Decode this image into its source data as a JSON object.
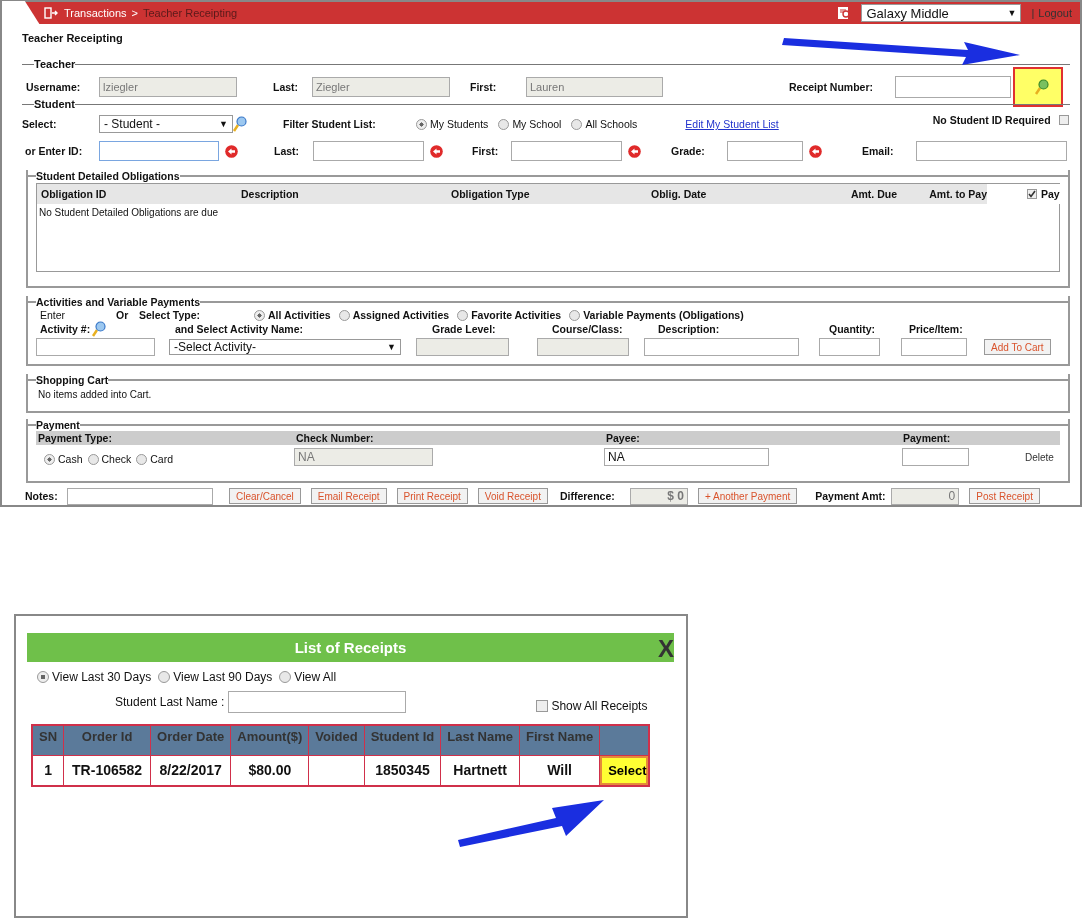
{
  "header": {
    "breadcrumb_root": "Transactions",
    "breadcrumb_separator": ">",
    "breadcrumb_current": "Teacher Receipting",
    "school": "Galaxy Middle",
    "school_caret": "▼",
    "separator": "|",
    "logout": "Logout"
  },
  "page_title": "Teacher Receipting",
  "teacher": {
    "legend": "Teacher",
    "fields": [
      {
        "label": "Username:",
        "value": "lziegler"
      },
      {
        "label": "Last:",
        "value": "Ziegler"
      },
      {
        "label": "First:",
        "value": "Lauren"
      }
    ],
    "receipt_label": "Receipt Number:"
  },
  "student": {
    "legend": "Student",
    "select_label": "Select:",
    "select_value": "- Student -",
    "select_caret": "▼",
    "filter_label": "Filter Student List:",
    "filter_options": [
      {
        "label": "My Students",
        "selected": true
      },
      {
        "label": "My School",
        "selected": false
      },
      {
        "label": "All Schools",
        "selected": false
      }
    ],
    "edit_link": "Edit My Student List",
    "no_id": {
      "label": "No Student ID Required",
      "checked": false
    },
    "id_label": "or Enter ID:",
    "search_fields": [
      {
        "label": "Last:"
      },
      {
        "label": "First:"
      },
      {
        "label": "Grade:"
      }
    ],
    "email_label": "Email:"
  },
  "obligations": {
    "legend": "Student Detailed Obligations",
    "columns": [
      "Obligation ID",
      "Description",
      "Obligation Type",
      "Oblig. Date",
      "Amt. Due",
      "Amt. to Pay"
    ],
    "pay": {
      "label": "Pay",
      "checked": true
    },
    "empty_message": "No Student Detailed Obligations are due"
  },
  "activities": {
    "legend": "Activities and Variable Payments",
    "enter_label": "Enter",
    "activity_label": "Activity #:",
    "or_label": "Or",
    "type_label": "Select Type:",
    "types": [
      {
        "label": "All Activities",
        "selected": true
      },
      {
        "label": "Assigned Activities",
        "selected": false
      },
      {
        "label": "Favorite Activities",
        "selected": false
      },
      {
        "label": "Variable Payments (Obligations)",
        "selected": false
      }
    ],
    "name_label": "and Select Activity Name:",
    "activity_select": "-Select Activity-",
    "activity_caret": "▼",
    "grade_label": "Grade Level:",
    "course_label": "Course/Class:",
    "description_label": "Description:",
    "quantity_label": "Quantity:",
    "price_label": "Price/Item:",
    "add_button": "Add To Cart"
  },
  "cart": {
    "legend": "Shopping Cart",
    "message": "No items added into Cart."
  },
  "payment": {
    "legend": "Payment",
    "headers": [
      "Payment Type:",
      "Check Number:",
      "Payee:",
      "Payment:"
    ],
    "methods": [
      {
        "label": "Cash",
        "selected": true
      },
      {
        "label": "Check",
        "selected": false
      },
      {
        "label": "Card",
        "selected": false
      }
    ],
    "check_number": "NA",
    "payee": "NA",
    "delete": "Delete"
  },
  "footer": {
    "notes_label": "Notes:",
    "buttons": [
      "Clear/Cancel",
      "Email Receipt",
      "Print Receipt",
      "Void Receipt"
    ],
    "difference_label": "Difference:",
    "difference": "$ 0",
    "another_payment": "+ Another Payment",
    "payment_amt_label": "Payment Amt:",
    "payment_amt": "0",
    "post_button": "Post Receipt"
  },
  "receipts_dialog": {
    "title": "List of Receipts",
    "close": "X",
    "ranges": [
      {
        "label": "View Last 30 Days",
        "selected": true
      },
      {
        "label": "View Last 90 Days",
        "selected": false
      },
      {
        "label": "View All",
        "selected": false
      }
    ],
    "last_name_label": "Student Last Name :",
    "show_all": {
      "label": "Show All Receipts",
      "checked": false
    },
    "columns": [
      "SN",
      "Order Id",
      "Order Date",
      "Amount($)",
      "Voided",
      "Student Id",
      "Last Name",
      "First Name",
      ""
    ],
    "rows": [
      {
        "cells": [
          "1",
          "TR-106582",
          "8/22/2017",
          "$80.00",
          "",
          "1850345",
          "Hartnett",
          "Will"
        ],
        "action": "Select"
      }
    ]
  }
}
